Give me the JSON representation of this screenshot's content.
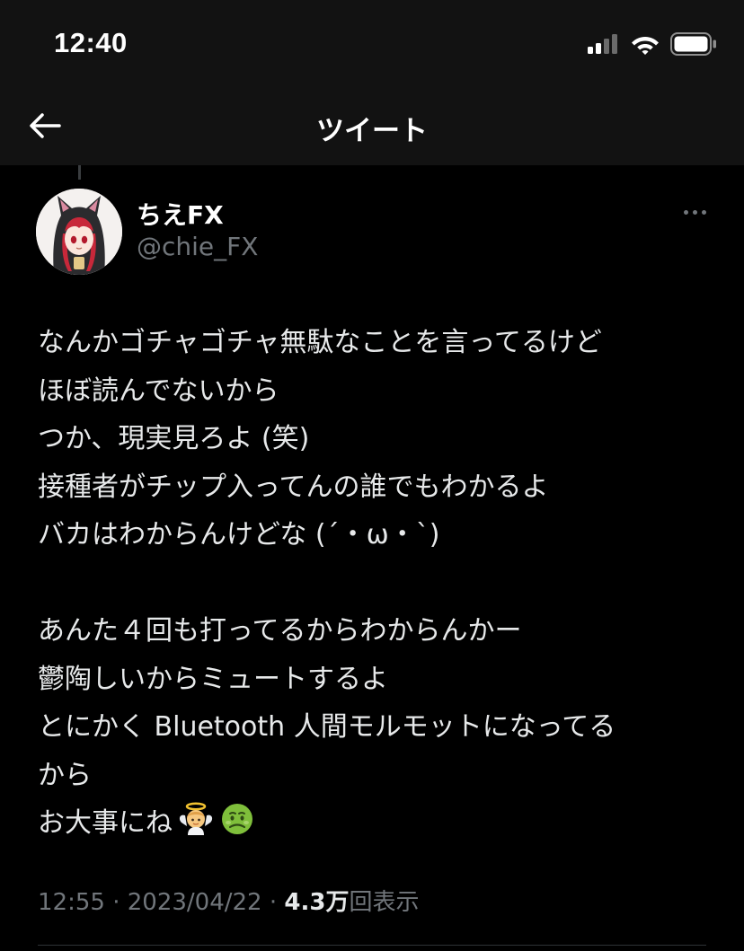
{
  "status_bar": {
    "time": "12:40",
    "icons": [
      "cellular-signal-icon",
      "wifi-icon",
      "battery-icon"
    ]
  },
  "nav": {
    "back_icon": "back-arrow-icon",
    "title": "ツイート"
  },
  "tweet": {
    "author": {
      "display_name": "ちえFX",
      "handle": "@chie_FX",
      "avatar": "cat-hood-avatar"
    },
    "more_icon": "more-options-icon",
    "lines": [
      "なんかゴチャゴチャ無駄なことを言ってるけど",
      "ほぼ読んでないから",
      "つか、現実見ろよ (笑)",
      "接種者がチップ入ってんの誰でもわかるよ",
      "バカはわからんけどな (´・ω・`)",
      "",
      "あんた４回も打ってるからわからんかー",
      "鬱陶しいからミュートするよ",
      "とにかく Bluetooth 人間モルモットになってる",
      "から",
      "お大事にね"
    ],
    "emojis": [
      "angel-baby-emoji",
      "nauseated-face-emoji"
    ],
    "time": "12:55",
    "date": "2023/04/22",
    "separator": "·",
    "views_count": "4.3万",
    "views_label": "回表示"
  },
  "colors": {
    "background": "#000000",
    "text": "#e7e9ea",
    "secondary": "#71767b",
    "header": "#121212"
  }
}
